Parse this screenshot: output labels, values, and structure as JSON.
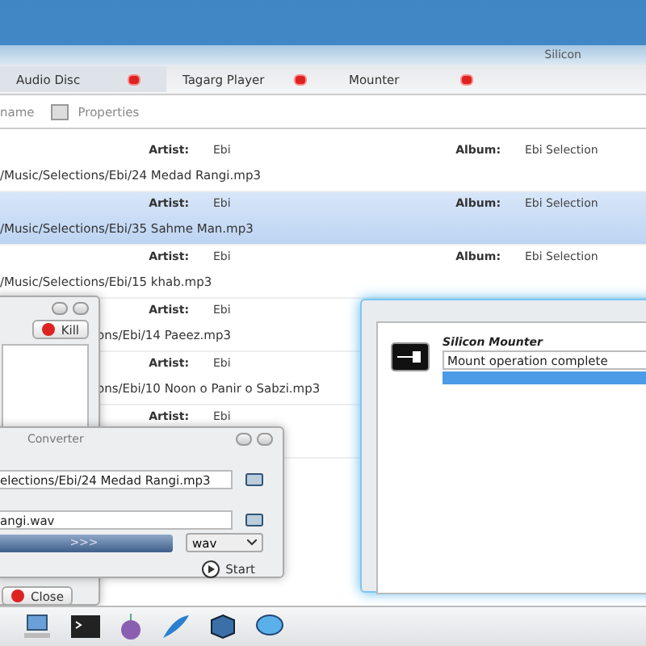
{
  "main_window": {
    "title": "Silicon",
    "tabs": [
      {
        "label": "Audio Disc",
        "selected": true
      },
      {
        "label": "Tagarg Player",
        "selected": false
      },
      {
        "label": "Mounter",
        "selected": false
      }
    ],
    "toolbar": [
      "name",
      "Properties"
    ],
    "rows": [
      {
        "kind": "full",
        "artist_label": "Artist:",
        "artist": "Ebi",
        "album_label": "Album:",
        "album": "Ebi Selection",
        "path": "/Music/Selections/Ebi/24 Medad Rangi.mp3",
        "selected": false
      },
      {
        "kind": "full",
        "artist_label": "Artist:",
        "artist": "Ebi",
        "album_label": "Album:",
        "album": "Ebi Selection",
        "path": "/Music/Selections/Ebi/35 Sahme Man.mp3",
        "selected": true
      },
      {
        "kind": "full",
        "artist_label": "Artist:",
        "artist": "Ebi",
        "album_label": "Album:",
        "album": "Ebi Selection",
        "path": "/Music/Selections/Ebi/15 khab.mp3",
        "selected": false
      },
      {
        "kind": "partial",
        "artist_label": "Artist:",
        "artist": "Ebi",
        "path": "ons/Ebi/14 Paeez.mp3",
        "selected": false
      },
      {
        "kind": "partial",
        "artist_label": "Artist:",
        "artist": "Ebi",
        "path": "ons/Ebi/10 Noon o Panir o Sabzi.mp3",
        "selected": false
      },
      {
        "kind": "partial",
        "artist_label": "Artist:",
        "artist": "Ebi",
        "selected": false
      }
    ]
  },
  "process_window": {
    "kill": "Kill",
    "close": "Close"
  },
  "converter": {
    "title": "Converter",
    "source": "elections/Ebi/24 Medad Rangi.mp3",
    "target": "angi.wav",
    "progress": {
      "label": ">>>",
      "level": 1
    },
    "format": "wav",
    "start": "Start"
  },
  "mounter_window": {
    "heading": "Silicon Mounter",
    "status": "Mount operation complete",
    "level": 1
  }
}
